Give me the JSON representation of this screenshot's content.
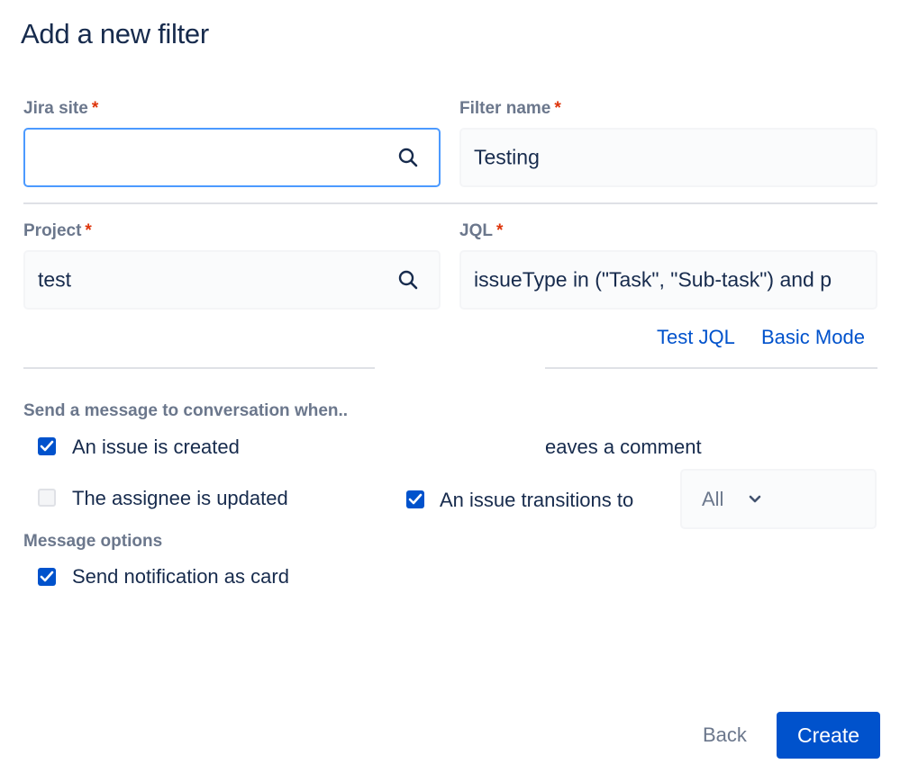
{
  "dialog": {
    "title": "Add a new filter"
  },
  "form": {
    "required_mark": "*",
    "jira_site": {
      "label": "Jira site",
      "value": ""
    },
    "filter_name": {
      "label": "Filter name",
      "value": "Testing"
    },
    "project": {
      "label": "Project",
      "value": "test"
    },
    "jql": {
      "label": "JQL",
      "value": "issueType in (\"Task\", \"Sub-task\") and p"
    },
    "links": {
      "test_jql": "Test JQL",
      "basic_mode": "Basic Mode"
    }
  },
  "triggers": {
    "heading": "Send a message to conversation when..",
    "items": [
      {
        "label": "An issue is created",
        "checked": true
      },
      {
        "label": "eaves a comment",
        "checked": true
      },
      {
        "label": "The assignee is updated",
        "checked": false
      },
      {
        "label": "An issue transitions to",
        "checked": true
      }
    ],
    "transition_select": {
      "value": "All"
    }
  },
  "options": {
    "heading": "Message options",
    "items": [
      {
        "label": "Send notification as card",
        "checked": true
      }
    ]
  },
  "footer": {
    "back_label": "Back",
    "create_label": "Create"
  },
  "colors": {
    "primary": "#0052cc",
    "focus_border": "#4c9aff",
    "required": "#de350b"
  },
  "icons": {
    "search": "search-icon",
    "check": "check-icon",
    "chevron": "chevron-down-icon"
  }
}
